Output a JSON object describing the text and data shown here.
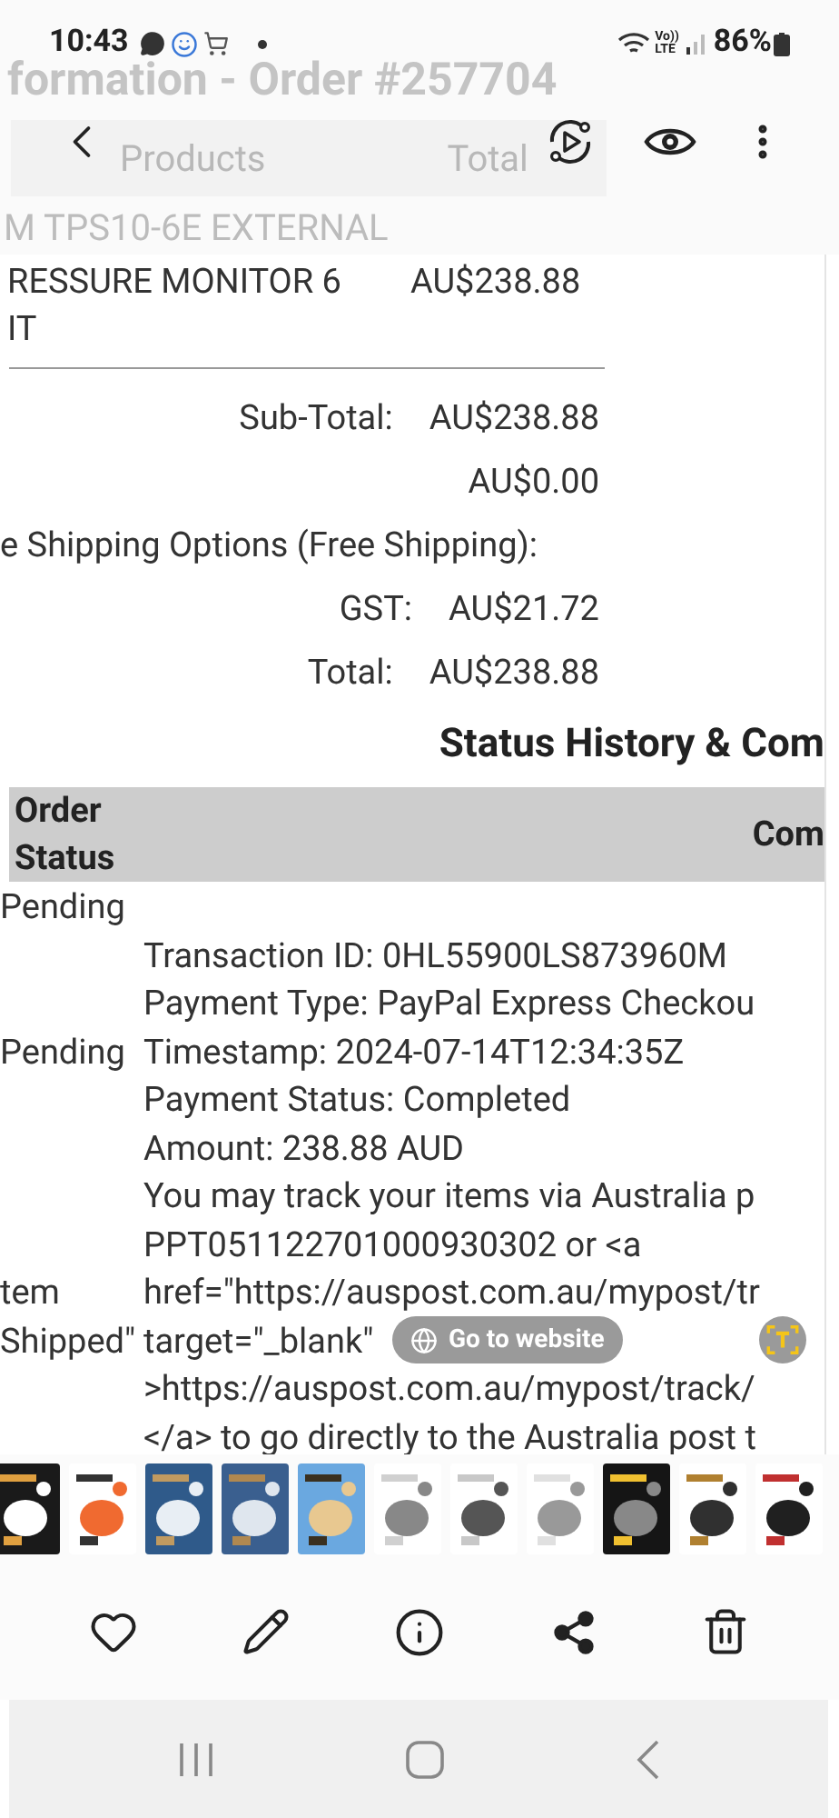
{
  "status_bar": {
    "time": "10:43",
    "network_labels": [
      "Vo))",
      "LTE"
    ],
    "battery": "86%"
  },
  "viewer_background": {
    "title": "formation - Order #257704",
    "columns": [
      "Products",
      "Total"
    ],
    "row": "M TPS10-6E EXTERNAL"
  },
  "order": {
    "product_lines": [
      "RESSURE MONITOR 6",
      "IT"
    ],
    "product_total": "AU$238.88",
    "totals": [
      {
        "label": "Sub-Total:",
        "value": "AU$238.88"
      },
      {
        "value": "AU$0.00"
      },
      {
        "label": "e Shipping Options (Free Shipping):"
      },
      {
        "label": "GST:",
        "value": "AU$21.72"
      },
      {
        "label": "Total:",
        "value": "AU$238.88"
      }
    ],
    "history_title": "Status History & Com",
    "columns": [
      "Order\nStatus",
      "Com"
    ],
    "lines": [
      {
        "status": "Pending"
      },
      {
        "comment": "Transaction ID: 0HL55900LS873960M"
      },
      {
        "comment": "Payment Type: PayPal Express Checkou"
      },
      {
        "status": "Pending",
        "comment": "Timestamp: 2024-07-14T12:34:35Z"
      },
      {
        "comment": "Payment Status: Completed"
      },
      {
        "comment": "Amount: 238.88 AUD"
      },
      {
        "comment": "You may track your items via Australia p"
      },
      {
        "comment": "PPT051122701000930302 or <a"
      },
      {
        "status": "tem",
        "comment": "href=\"https://auspost.com.au/mypost/tr"
      },
      {
        "status": "Shipped\"",
        "comment": "target=\"_blank\""
      },
      {
        "comment": ">https://auspost.com.au/mypost/track/"
      },
      {
        "comment": "</a> to go directly to the Australia post t"
      }
    ]
  },
  "website_button": {
    "label": "Go to website"
  }
}
